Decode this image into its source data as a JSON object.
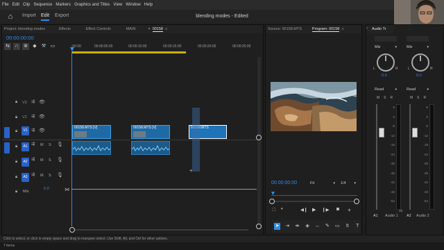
{
  "menu": [
    "File",
    "Edit",
    "Clip",
    "Sequence",
    "Markers",
    "Graphics and Titles",
    "View",
    "Window",
    "Help"
  ],
  "workspaces": {
    "import": "Import",
    "edit": "Edit",
    "export": "Export"
  },
  "document_title": "blending modes - Edited",
  "timeline_panel": {
    "tabs": [
      "Project: blending modes",
      "Effects",
      "Effect Controls",
      "MAIN",
      "00158"
    ],
    "close_symbol": "×",
    "menu_symbol": "≡",
    "timecode": "00:00:00:00",
    "ruler": [
      ":00:00",
      "00:00:05:00",
      "00:00:10:00",
      "00:00:15:00",
      "00:00:20:00",
      "00:00:25:00"
    ],
    "tracks_video": [
      "V3",
      "V2",
      "V1"
    ],
    "tracks_audio": [
      "A1",
      "A2",
      "A3"
    ],
    "mix_label": "Mix",
    "mix_value": "0.0",
    "mute_label": "M",
    "solo_label": "S",
    "clips": [
      "00158.MTS [V]",
      "00158.MTS [V]",
      "00158.MTS"
    ]
  },
  "source_monitor": {
    "tab": "Source: 00158.MTS"
  },
  "program_monitor": {
    "tab": "Program: 00158",
    "timecode": "00:00:00:00",
    "fit": "Fit",
    "resolution": "1/4"
  },
  "audio_mixer": {
    "tab": "Audio Tr",
    "channels": [
      {
        "dropdown": "Mix",
        "pan_l": "L",
        "pan_r": "R",
        "value": "0.0",
        "mode": "Read",
        "name": "A1",
        "label": "Audio 1"
      },
      {
        "dropdown": "Mix",
        "pan_l": "L",
        "pan_r": "R",
        "value": "0.0",
        "mode": "Read",
        "name": "A2",
        "label": "Audio 2"
      }
    ],
    "msr": [
      "M",
      "S",
      "R"
    ],
    "scale": [
      "6",
      "0",
      "-6",
      "-12",
      "-18",
      "-24",
      "-30",
      "-36",
      "-42",
      "-48",
      "-54",
      "dB"
    ]
  },
  "status_text": "Click to select, or click in empty space and drag to marquee select. Use Shift, Alt, and Ctrl for other options.",
  "footer_text": "7 items"
}
